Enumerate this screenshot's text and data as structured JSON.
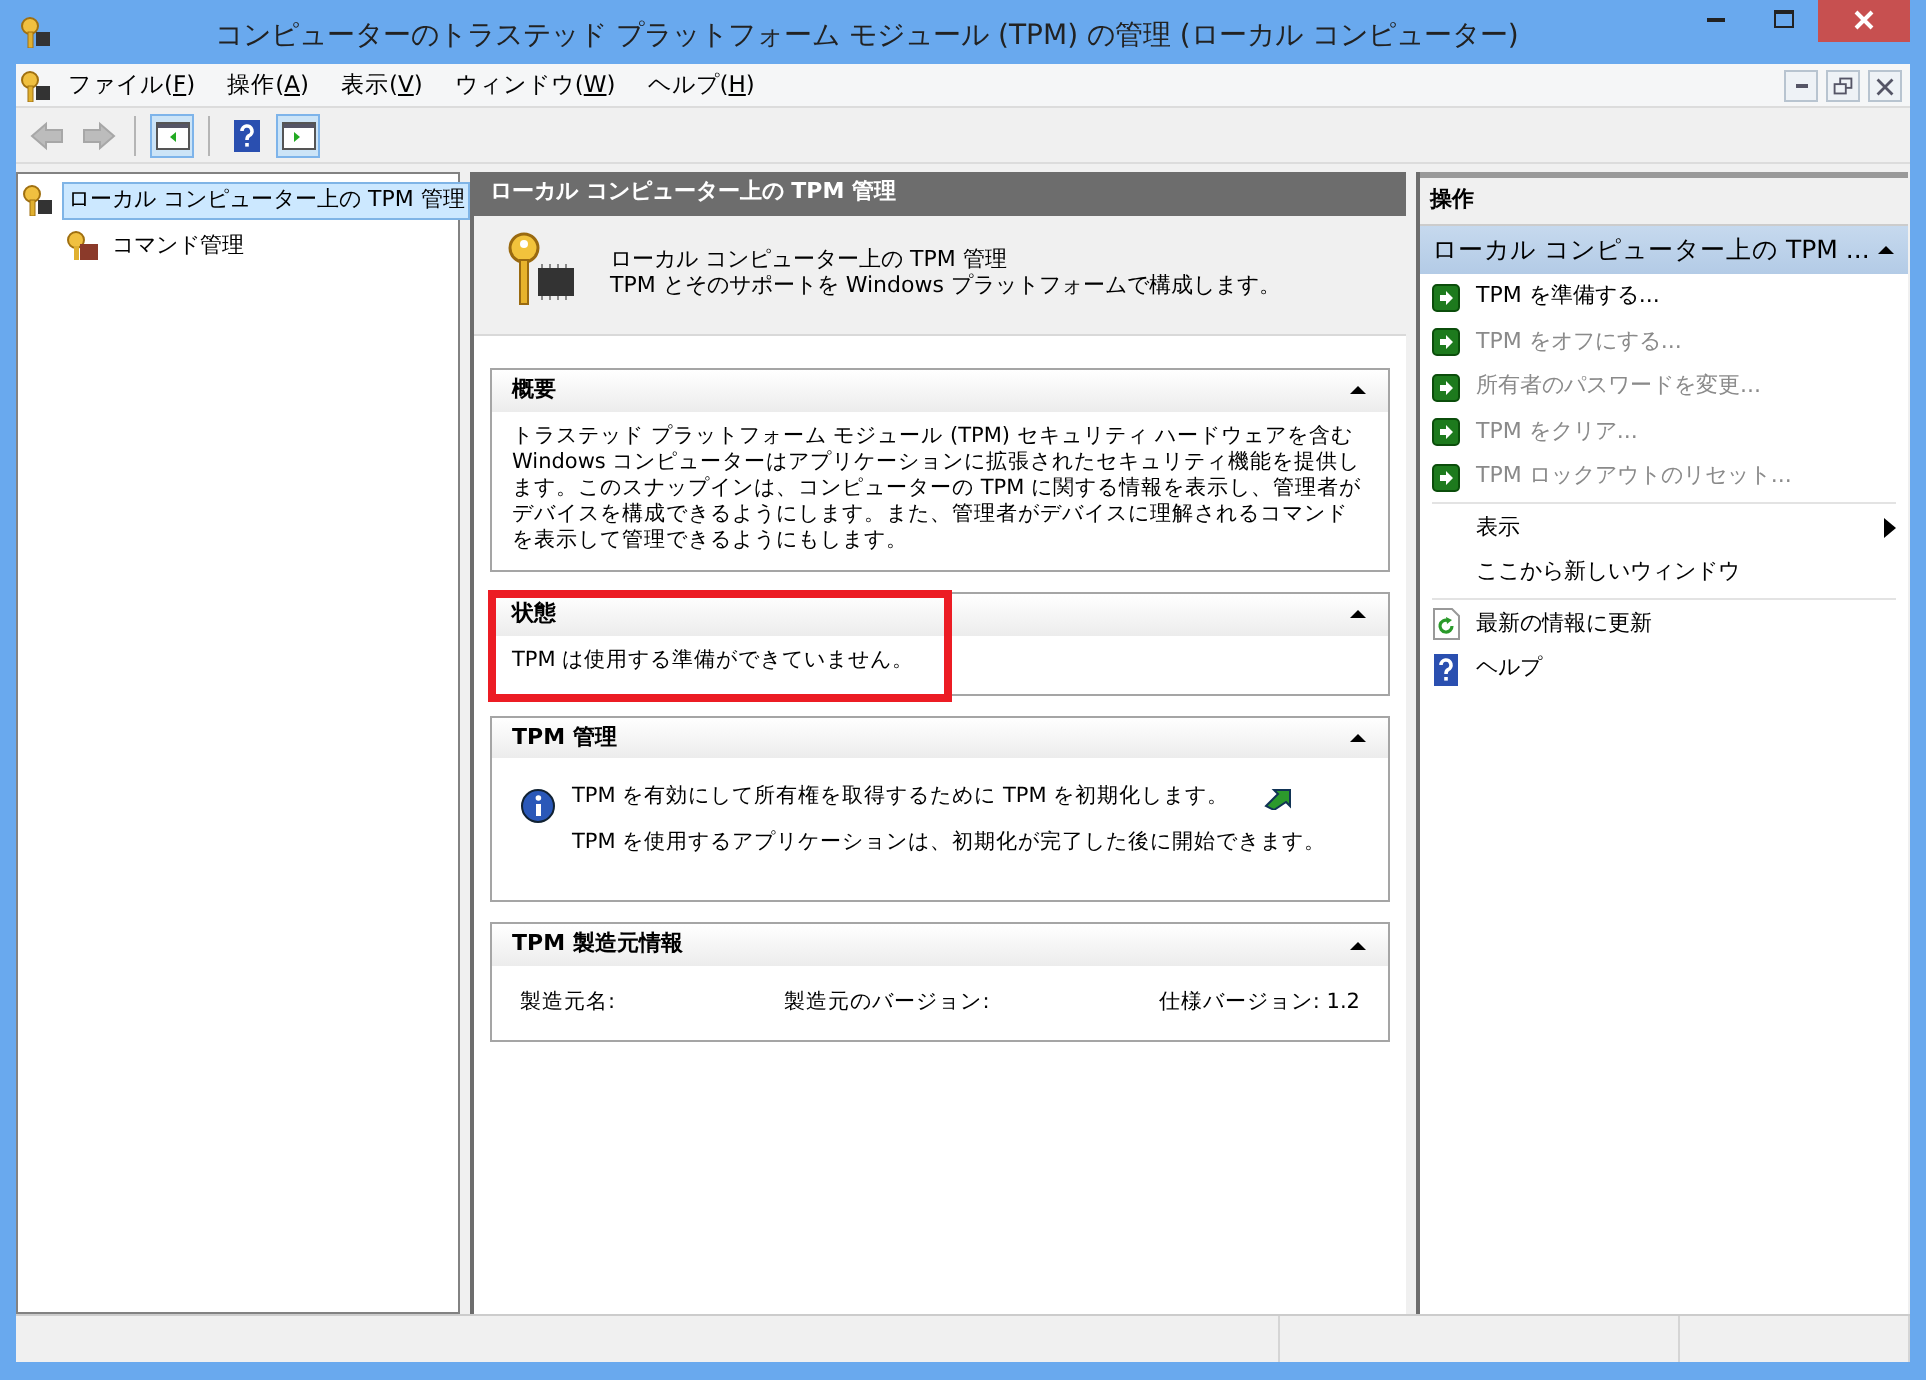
{
  "window": {
    "title": "コンピューターのトラステッド プラットフォーム モジュール (TPM) の管理 (ローカル コンピューター)"
  },
  "menu": [
    {
      "label": "ファイル(",
      "key": "F",
      "end": ")"
    },
    {
      "label": "操作(",
      "key": "A",
      "end": ")"
    },
    {
      "label": "表示(",
      "key": "V",
      "end": ")"
    },
    {
      "label": "ウィンドウ(",
      "key": "W",
      "end": ")"
    },
    {
      "label": "ヘルプ(",
      "key": "H",
      "end": ")"
    }
  ],
  "toolbar": [
    {
      "kind": "back",
      "disabled": true,
      "selected": false
    },
    {
      "kind": "forward",
      "disabled": true,
      "selected": false
    },
    {
      "kind": "tree-pane",
      "disabled": false,
      "selected": true
    },
    {
      "kind": "help",
      "disabled": false,
      "selected": false
    },
    {
      "kind": "action-pane",
      "disabled": false,
      "selected": true
    }
  ],
  "tree": [
    {
      "label": "ローカル コンピューター上の TPM 管理",
      "selected": true,
      "children": [
        {
          "label": "コマンド管理",
          "selected": false
        }
      ]
    }
  ],
  "center": {
    "header": "ローカル コンピューター上の TPM 管理",
    "intro_title": "ローカル コンピューター上の TPM 管理",
    "intro_text": "TPM とそのサポートを Windows プラットフォームで構成します。",
    "sections": [
      {
        "kind": "text",
        "title": "概要",
        "expanded": true,
        "highlighted": false,
        "text": "トラステッド プラットフォーム モジュール (TPM) セキュリティ ハードウェアを含む Windows コンピューターはアプリケーションに拡張されたセキュリティ機能を提供します。このスナップインは、コンピューターの TPM に関する情報を表示し、管理者がデバイスを構成できるようにします。また、管理者がデバイスに理解されるコマンドを表示して管理できるようにもします。"
      },
      {
        "kind": "text",
        "title": "状態",
        "expanded": true,
        "highlighted": true,
        "text": "TPM は使用する準備ができていません。"
      },
      {
        "kind": "info",
        "title": "TPM 管理",
        "expanded": true,
        "highlighted": false,
        "lines": [
          "TPM を有効にして所有権を取得するために TPM を初期化します。",
          "TPM を使用するアプリケーションは、初期化が完了した後に開始できます。"
        ]
      },
      {
        "kind": "fields",
        "title": "TPM 製造元情報",
        "expanded": true,
        "highlighted": false,
        "fields": [
          {
            "label": "製造元名:"
          },
          {
            "label": "製造元のバージョン:"
          },
          {
            "label": "仕様バージョン:",
            "value": "1.2"
          }
        ]
      }
    ]
  },
  "actions": {
    "header": "操作",
    "group_title": "ローカル コンピューター上の TPM ...",
    "expanded": true,
    "item_groups": [
      [
        {
          "kind": "command",
          "label": "TPM を準備する...",
          "disabled": false
        },
        {
          "kind": "command",
          "label": "TPM をオフにする...",
          "disabled": true
        },
        {
          "kind": "command",
          "label": "所有者のパスワードを変更...",
          "disabled": true
        },
        {
          "kind": "command",
          "label": "TPM をクリア...",
          "disabled": true
        },
        {
          "kind": "command",
          "label": "TPM ロックアウトのリセット...",
          "disabled": true
        }
      ],
      [
        {
          "kind": "submenu",
          "label": "表示",
          "disabled": false
        },
        {
          "kind": "plain",
          "label": "ここから新しいウィンドウ",
          "disabled": false
        }
      ],
      [
        {
          "kind": "refresh",
          "label": "最新の情報に更新",
          "disabled": false
        },
        {
          "kind": "help",
          "label": "ヘルプ",
          "disabled": false
        }
      ]
    ]
  }
}
